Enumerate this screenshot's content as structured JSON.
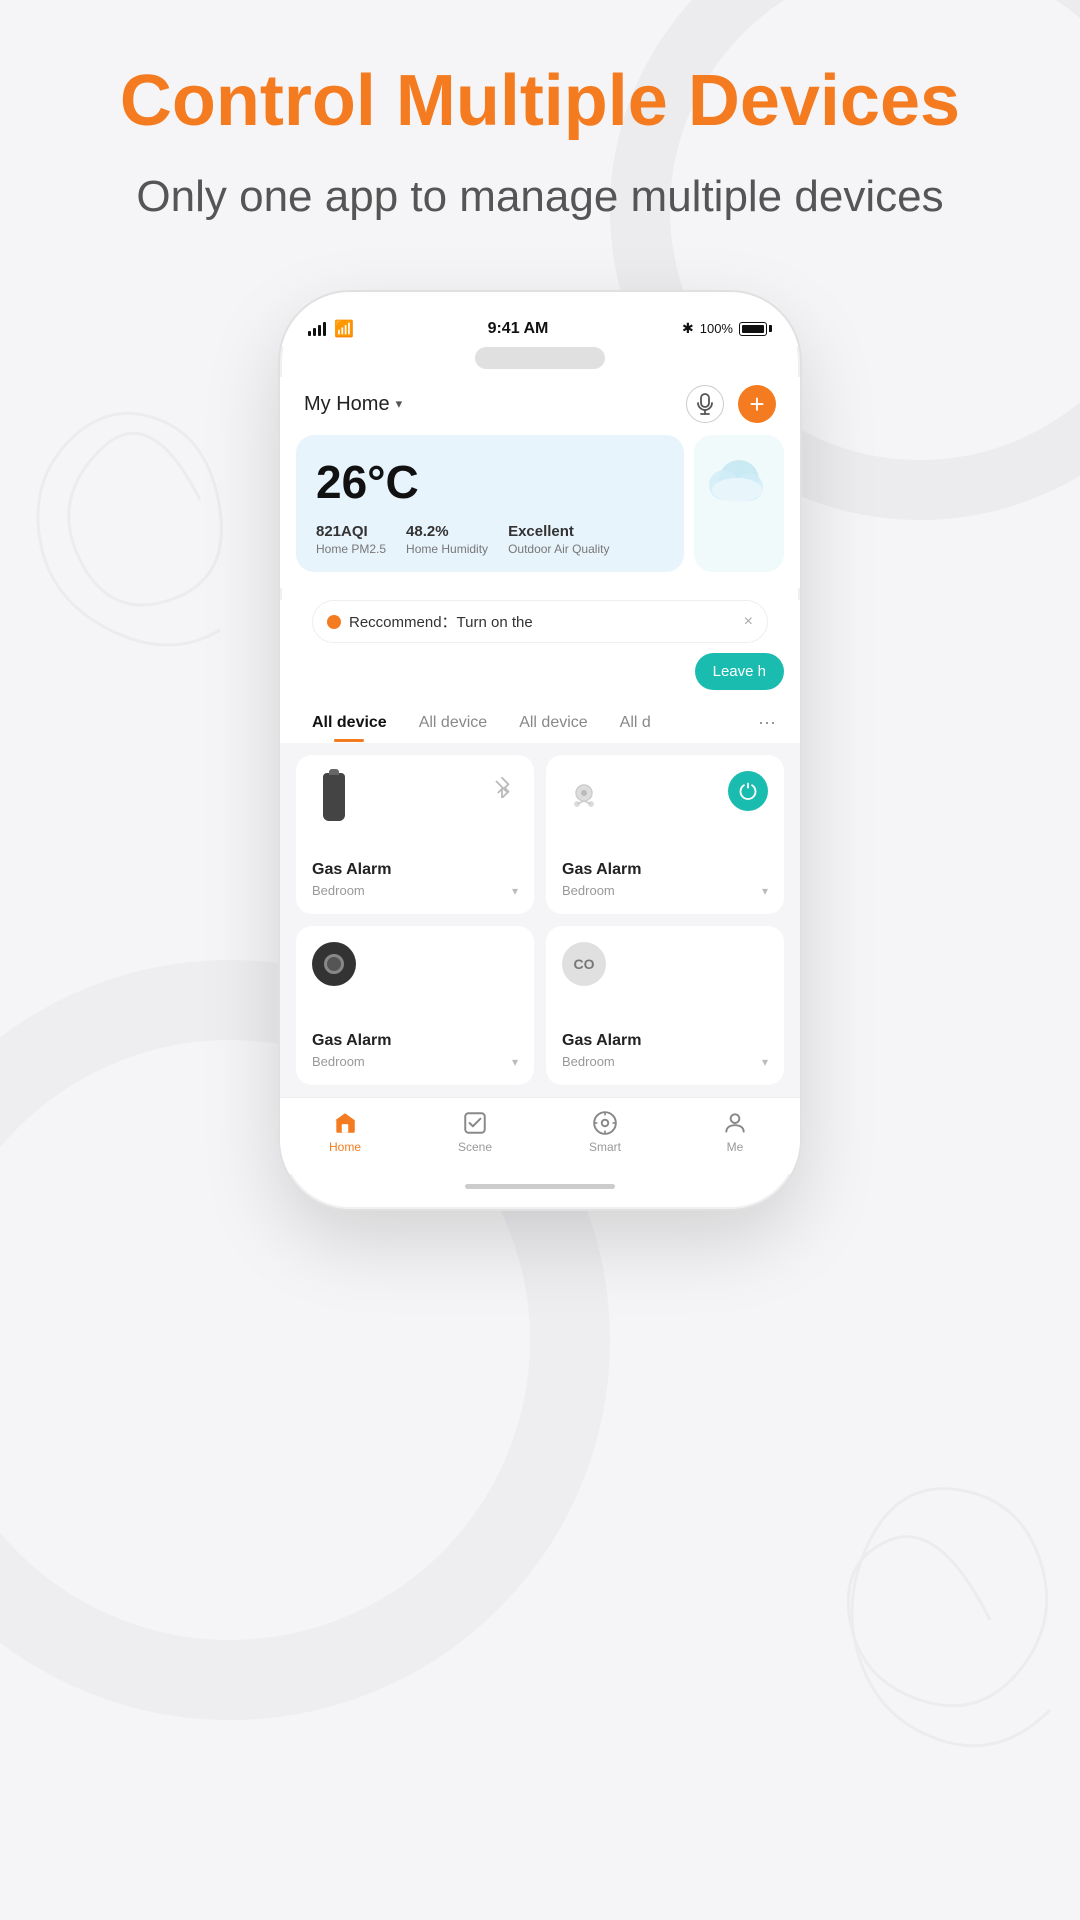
{
  "page": {
    "title": "Control Multiple Devices",
    "subtitle": "Only one app to manage multiple devices"
  },
  "phone": {
    "status_bar": {
      "time": "9:41 AM",
      "battery_percent": "100%",
      "bluetooth": "✱"
    },
    "header": {
      "home_name": "My Home",
      "dropdown_char": "▾",
      "mic_icon": "🎙",
      "add_icon": "+"
    },
    "weather": {
      "temperature": "26°C",
      "aqi_value": "821AQI",
      "aqi_label": "Home PM2.5",
      "humidity_value": "48.2%",
      "humidity_label": "Home Humidity",
      "air_value": "Excellent",
      "air_label": "Outdoor Air Quality"
    },
    "recommendation": {
      "text": "Reccommend：Turn on the",
      "close": "×",
      "action": "Leave h"
    },
    "tabs": [
      {
        "label": "All device",
        "active": true
      },
      {
        "label": "All device",
        "active": false
      },
      {
        "label": "All device",
        "active": false
      },
      {
        "label": "All d",
        "active": false
      }
    ],
    "devices": [
      {
        "name": "Gas Alarm",
        "room": "Bedroom",
        "icon_type": "cylinder",
        "has_bt": true
      },
      {
        "name": "Gas Alarm",
        "room": "Bedroom",
        "icon_type": "speaker",
        "has_power": true
      },
      {
        "name": "Gas Alarm",
        "room": "Bedroom",
        "icon_type": "camera"
      },
      {
        "name": "Gas Alarm",
        "room": "Bedroom",
        "icon_type": "co"
      }
    ],
    "nav": [
      {
        "label": "Home",
        "icon": "⌂",
        "active": true
      },
      {
        "label": "Scene",
        "icon": "☑",
        "active": false
      },
      {
        "label": "Smart",
        "icon": "◎",
        "active": false
      },
      {
        "label": "Me",
        "icon": "⊙",
        "active": false
      }
    ]
  }
}
